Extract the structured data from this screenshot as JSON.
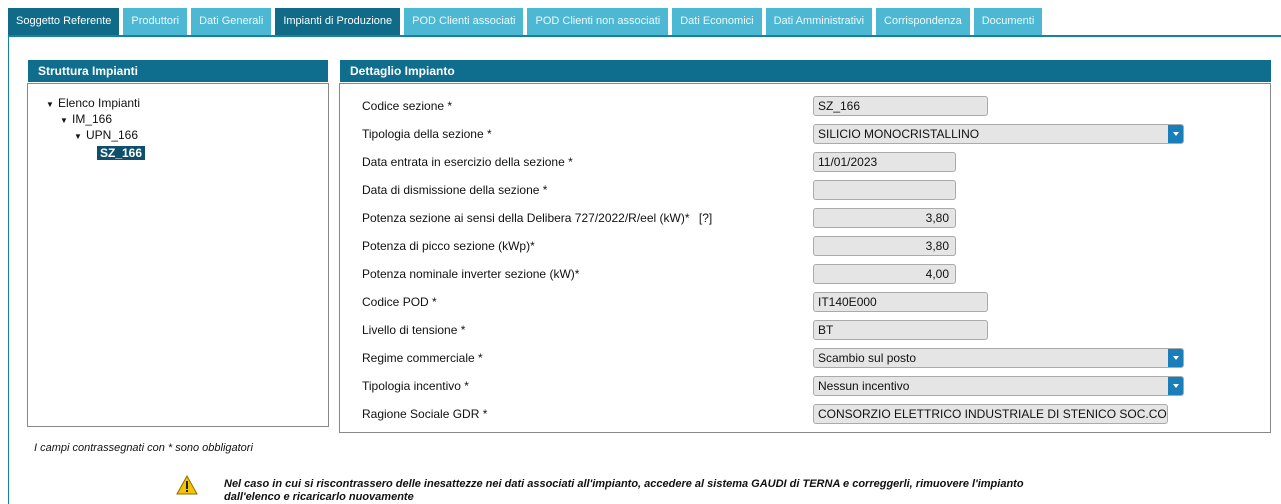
{
  "tabs": [
    {
      "label": "Soggetto Referente",
      "active": true
    },
    {
      "label": "Produttori",
      "active": false
    },
    {
      "label": "Dati Generali",
      "active": false
    },
    {
      "label": "Impianti di Produzione",
      "active": true
    },
    {
      "label": "POD Clienti associati",
      "active": false
    },
    {
      "label": "POD Clienti non associati",
      "active": false
    },
    {
      "label": "Dati Economici",
      "active": false
    },
    {
      "label": "Dati Amministrativi",
      "active": false
    },
    {
      "label": "Corrispondenza",
      "active": false
    },
    {
      "label": "Documenti",
      "active": false
    }
  ],
  "left_panel": {
    "title": "Struttura Impianti",
    "tree": {
      "root": "Elenco Impianti",
      "impianto": "IM_166",
      "upn": "UPN_166",
      "sezione": "SZ_166"
    }
  },
  "right_panel": {
    "title": "Dettaglio Impianto",
    "fields": {
      "codice_sezione": {
        "label": "Codice sezione *",
        "value": "SZ_166"
      },
      "tipologia_sezione": {
        "label": "Tipologia della sezione *",
        "value": "SILICIO MONOCRISTALLINO"
      },
      "data_entrata": {
        "label": "Data entrata in esercizio della sezione *",
        "value": "11/01/2023"
      },
      "data_dismissione": {
        "label": "Data di dismissione della sezione *",
        "value": ""
      },
      "potenza_delibera": {
        "label": "Potenza sezione ai sensi della Delibera 727/2022/R/eel (kW)*",
        "help": "[?]",
        "value": "3,80"
      },
      "potenza_picco": {
        "label": "Potenza di picco sezione (kWp)*",
        "value": "3,80"
      },
      "potenza_inverter": {
        "label": "Potenza nominale inverter sezione (kW)*",
        "value": "4,00"
      },
      "codice_pod": {
        "label": "Codice POD *",
        "value": "IT140E000"
      },
      "livello_tensione": {
        "label": "Livello di tensione *",
        "value": "BT"
      },
      "regime_commerciale": {
        "label": "Regime commerciale *",
        "value": "Scambio sul posto"
      },
      "tipologia_incentivo": {
        "label": "Tipologia incentivo *",
        "value": "Nessun incentivo"
      },
      "ragione_sociale": {
        "label": "Ragione Sociale GDR *",
        "value": "CONSORZIO ELETTRICO INDUSTRIALE DI STENICO SOC.CO"
      }
    }
  },
  "footer": {
    "required_note": "I campi contrassegnati con * sono obbligatori",
    "warning": "Nel caso in cui si riscontrassero delle inesattezze nei dati associati all'impianto, accedere al sistema GAUDI di TERNA e correggerli, rimuovere l'impianto dall'elenco e ricaricarlo nuovamente"
  },
  "colors": {
    "tab_active": "#0f6b88",
    "tab_inactive": "#4db8d4",
    "panel_header": "#0f6e8d",
    "select_button": "#1a7fb8"
  }
}
